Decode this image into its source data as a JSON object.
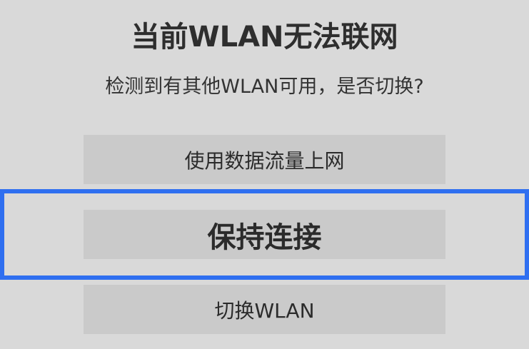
{
  "dialog": {
    "title": "当前WLAN无法联网",
    "message": "检测到有其他WLAN可用，是否切换?",
    "options": [
      {
        "label": "使用数据流量上网"
      },
      {
        "label": "保持连接",
        "focused": true
      },
      {
        "label": "切换WLAN"
      }
    ],
    "focus_color": "#2f6ff0",
    "background_color": "#d9d9d9",
    "button_color": "#cacaca"
  }
}
